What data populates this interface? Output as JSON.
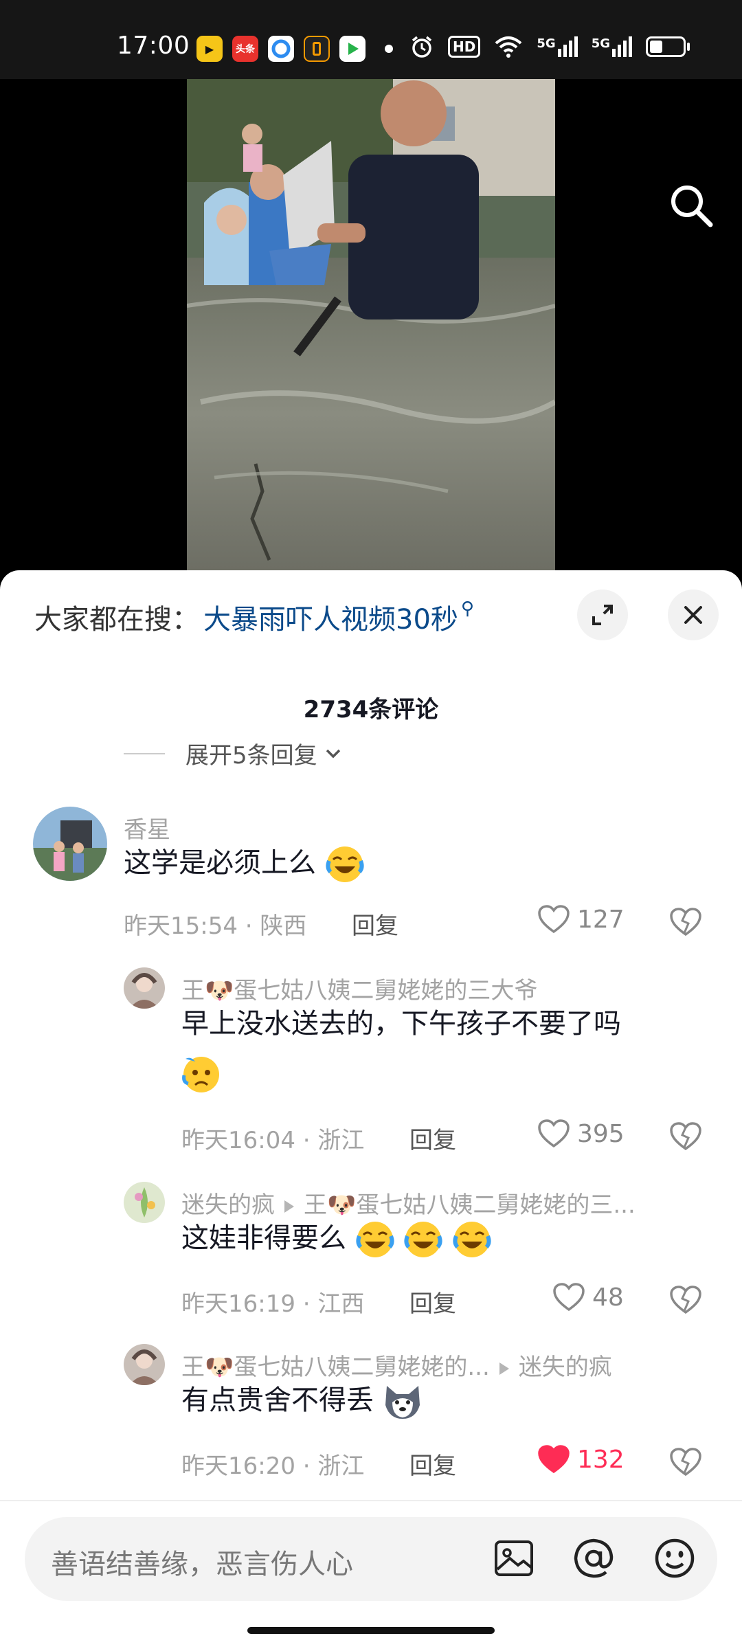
{
  "status_bar": {
    "time": "17:00",
    "apps": [
      {
        "icon": "toutiao-lite-icon",
        "color": "#f5c518"
      },
      {
        "icon": "toutiao-icon",
        "label": "头条",
        "color": "#e8322d"
      },
      {
        "icon": "browser-icon",
        "color": "#2d8cf0"
      },
      {
        "icon": "app-orange-icon",
        "color": "#222222"
      },
      {
        "icon": "video-app-icon",
        "color": "#26b24a"
      }
    ],
    "indicators": [
      "alarm-icon",
      "hd-icon",
      "wifi-icon",
      "signal-5g-icon",
      "signal-5g-icon",
      "battery-icon"
    ],
    "hd_label": "HD",
    "network_labels": [
      "5G",
      "5G"
    ]
  },
  "search_bar": {
    "prefix": "大家都在搜：",
    "term": "大暴雨吓人视频30秒"
  },
  "comments_header": {
    "count_label": "2734条评论",
    "expand_label": "展开5条回复"
  },
  "comments": [
    {
      "name": "香星",
      "text": "这学是必须上么",
      "emoji_count": 1,
      "time": "昨天15:54",
      "location": "陕西",
      "reply_label": "回复",
      "likes": "127",
      "liked": false
    },
    {
      "name": "王🐶蛋七姑八姨二舅姥姥的三大爷",
      "text": "早上没水送去的，下午孩子不要了吗",
      "emoji_count": 1,
      "time": "昨天16:04",
      "location": "浙江",
      "reply_label": "回复",
      "likes": "395",
      "liked": false
    },
    {
      "name": "迷失的疯",
      "reply_to": "王🐶蛋七姑八姨二舅姥姥的三...",
      "text": "这娃非得要么",
      "emoji_count": 3,
      "time": "昨天16:19",
      "location": "江西",
      "reply_label": "回复",
      "likes": "48",
      "liked": false
    },
    {
      "name": "王🐶蛋七姑八姨二舅姥姥的...",
      "reply_to": "迷失的疯",
      "text": "有点贵舍不得丢",
      "emoji_count": 1,
      "time": "昨天16:20",
      "location": "浙江",
      "reply_label": "回复",
      "likes": "132",
      "liked": true
    }
  ],
  "input_bar": {
    "placeholder": "善语结善缘，恶言伤人心"
  },
  "colors": {
    "accent_link": "#0b4a8a",
    "like_red": "#fe2c55",
    "meta_gray": "#a3a3a3"
  }
}
